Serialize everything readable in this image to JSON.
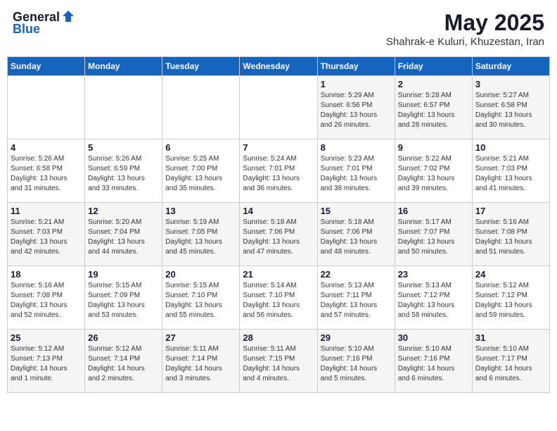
{
  "header": {
    "logo_general": "General",
    "logo_blue": "Blue",
    "month_title": "May 2025",
    "subtitle": "Shahrak-e Kuluri, Khuzestan, Iran"
  },
  "days_of_week": [
    "Sunday",
    "Monday",
    "Tuesday",
    "Wednesday",
    "Thursday",
    "Friday",
    "Saturday"
  ],
  "weeks": [
    [
      {
        "day": "",
        "info": ""
      },
      {
        "day": "",
        "info": ""
      },
      {
        "day": "",
        "info": ""
      },
      {
        "day": "",
        "info": ""
      },
      {
        "day": "1",
        "info": "Sunrise: 5:29 AM\nSunset: 6:56 PM\nDaylight: 13 hours\nand 26 minutes."
      },
      {
        "day": "2",
        "info": "Sunrise: 5:28 AM\nSunset: 6:57 PM\nDaylight: 13 hours\nand 28 minutes."
      },
      {
        "day": "3",
        "info": "Sunrise: 5:27 AM\nSunset: 6:58 PM\nDaylight: 13 hours\nand 30 minutes."
      }
    ],
    [
      {
        "day": "4",
        "info": "Sunrise: 5:26 AM\nSunset: 6:58 PM\nDaylight: 13 hours\nand 31 minutes."
      },
      {
        "day": "5",
        "info": "Sunrise: 5:26 AM\nSunset: 6:59 PM\nDaylight: 13 hours\nand 33 minutes."
      },
      {
        "day": "6",
        "info": "Sunrise: 5:25 AM\nSunset: 7:00 PM\nDaylight: 13 hours\nand 35 minutes."
      },
      {
        "day": "7",
        "info": "Sunrise: 5:24 AM\nSunset: 7:01 PM\nDaylight: 13 hours\nand 36 minutes."
      },
      {
        "day": "8",
        "info": "Sunrise: 5:23 AM\nSunset: 7:01 PM\nDaylight: 13 hours\nand 38 minutes."
      },
      {
        "day": "9",
        "info": "Sunrise: 5:22 AM\nSunset: 7:02 PM\nDaylight: 13 hours\nand 39 minutes."
      },
      {
        "day": "10",
        "info": "Sunrise: 5:21 AM\nSunset: 7:03 PM\nDaylight: 13 hours\nand 41 minutes."
      }
    ],
    [
      {
        "day": "11",
        "info": "Sunrise: 5:21 AM\nSunset: 7:03 PM\nDaylight: 13 hours\nand 42 minutes."
      },
      {
        "day": "12",
        "info": "Sunrise: 5:20 AM\nSunset: 7:04 PM\nDaylight: 13 hours\nand 44 minutes."
      },
      {
        "day": "13",
        "info": "Sunrise: 5:19 AM\nSunset: 7:05 PM\nDaylight: 13 hours\nand 45 minutes."
      },
      {
        "day": "14",
        "info": "Sunrise: 5:18 AM\nSunset: 7:06 PM\nDaylight: 13 hours\nand 47 minutes."
      },
      {
        "day": "15",
        "info": "Sunrise: 5:18 AM\nSunset: 7:06 PM\nDaylight: 13 hours\nand 48 minutes."
      },
      {
        "day": "16",
        "info": "Sunrise: 5:17 AM\nSunset: 7:07 PM\nDaylight: 13 hours\nand 50 minutes."
      },
      {
        "day": "17",
        "info": "Sunrise: 5:16 AM\nSunset: 7:08 PM\nDaylight: 13 hours\nand 51 minutes."
      }
    ],
    [
      {
        "day": "18",
        "info": "Sunrise: 5:16 AM\nSunset: 7:08 PM\nDaylight: 13 hours\nand 52 minutes."
      },
      {
        "day": "19",
        "info": "Sunrise: 5:15 AM\nSunset: 7:09 PM\nDaylight: 13 hours\nand 53 minutes."
      },
      {
        "day": "20",
        "info": "Sunrise: 5:15 AM\nSunset: 7:10 PM\nDaylight: 13 hours\nand 55 minutes."
      },
      {
        "day": "21",
        "info": "Sunrise: 5:14 AM\nSunset: 7:10 PM\nDaylight: 13 hours\nand 56 minutes."
      },
      {
        "day": "22",
        "info": "Sunrise: 5:13 AM\nSunset: 7:11 PM\nDaylight: 13 hours\nand 57 minutes."
      },
      {
        "day": "23",
        "info": "Sunrise: 5:13 AM\nSunset: 7:12 PM\nDaylight: 13 hours\nand 58 minutes."
      },
      {
        "day": "24",
        "info": "Sunrise: 5:12 AM\nSunset: 7:12 PM\nDaylight: 13 hours\nand 59 minutes."
      }
    ],
    [
      {
        "day": "25",
        "info": "Sunrise: 5:12 AM\nSunset: 7:13 PM\nDaylight: 14 hours\nand 1 minute."
      },
      {
        "day": "26",
        "info": "Sunrise: 5:12 AM\nSunset: 7:14 PM\nDaylight: 14 hours\nand 2 minutes."
      },
      {
        "day": "27",
        "info": "Sunrise: 5:11 AM\nSunset: 7:14 PM\nDaylight: 14 hours\nand 3 minutes."
      },
      {
        "day": "28",
        "info": "Sunrise: 5:11 AM\nSunset: 7:15 PM\nDaylight: 14 hours\nand 4 minutes."
      },
      {
        "day": "29",
        "info": "Sunrise: 5:10 AM\nSunset: 7:16 PM\nDaylight: 14 hours\nand 5 minutes."
      },
      {
        "day": "30",
        "info": "Sunrise: 5:10 AM\nSunset: 7:16 PM\nDaylight: 14 hours\nand 6 minutes."
      },
      {
        "day": "31",
        "info": "Sunrise: 5:10 AM\nSunset: 7:17 PM\nDaylight: 14 hours\nand 6 minutes."
      }
    ]
  ]
}
